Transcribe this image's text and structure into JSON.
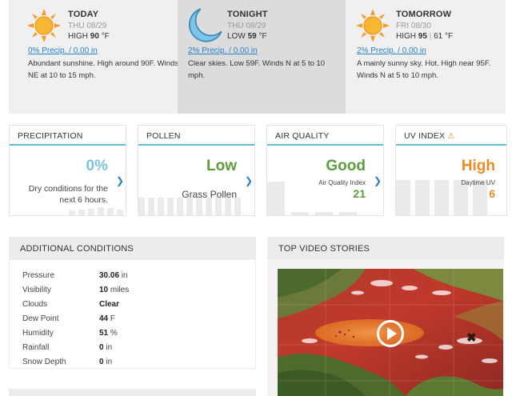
{
  "forecast": [
    {
      "day": "TODAY",
      "date": "THU 08/29",
      "temp_label": "HIGH",
      "temp": "90",
      "unit": "°F",
      "alt_temp": "",
      "precip": "0% Precip. / 0.00 in",
      "desc": "Abundant sunshine. High around 90F. Winds NE at 10 to 15 mph.",
      "icon": "sun-icon"
    },
    {
      "day": "TONIGHT",
      "date": "THU 08/29",
      "temp_label": "LOW",
      "temp": "59",
      "unit": "°F",
      "alt_temp": "",
      "precip": "2% Precip. / 0.00 in",
      "desc": "Clear skies. Low 59F. Winds N at 5 to 10 mph.",
      "icon": "moon-icon"
    },
    {
      "day": "TOMORROW",
      "date": "FRI 08/30",
      "temp_label": "HIGH",
      "temp": "95",
      "unit": "°F",
      "alt_temp": "61",
      "precip": "2% Precip. / 0.00 in",
      "desc": "A mainly sunny sky. Hot. High near 95F. Winds N at 5 to 10 mph.",
      "icon": "sun-icon"
    }
  ],
  "cards": {
    "precipitation": {
      "title": "PRECIPITATION",
      "value": "0%",
      "sub": "Dry conditions for the next 6 hours.",
      "color": "#7dc3e0"
    },
    "pollen": {
      "title": "POLLEN",
      "value": "Low",
      "sub": "Grass Pollen",
      "color": "#5c9e3c"
    },
    "air": {
      "title": "AIR QUALITY",
      "value": "Good",
      "sub": "Air Quality Index",
      "index": "21",
      "color": "#5c9e3c"
    },
    "uv": {
      "title": "UV INDEX",
      "value": "High",
      "sub": "Daytime UV",
      "index": "6",
      "color": "#f08a24",
      "warn_icon": "warning-icon"
    }
  },
  "additional": {
    "title": "ADDITIONAL CONDITIONS",
    "rows": [
      {
        "label": "Pressure",
        "value": "30.06",
        "unit": "in",
        "bold": false
      },
      {
        "label": "Visibility",
        "value": "10",
        "unit": "miles",
        "bold": false
      },
      {
        "label": "Clouds",
        "value": "Clear",
        "unit": "",
        "bold": true
      },
      {
        "label": "Dew Point",
        "value": "44",
        "unit": "F",
        "bold": false
      },
      {
        "label": "Humidity",
        "value": "51",
        "unit": "%",
        "bold": false
      },
      {
        "label": "Rainfall",
        "value": "0",
        "unit": "in",
        "bold": false
      },
      {
        "label": "Snow Depth",
        "value": "0",
        "unit": "in",
        "bold": false
      }
    ]
  },
  "video": {
    "title": "TOP VIDEO STORIES",
    "play_icon": "play-icon",
    "storm_icon": "storm-marker-icon"
  }
}
